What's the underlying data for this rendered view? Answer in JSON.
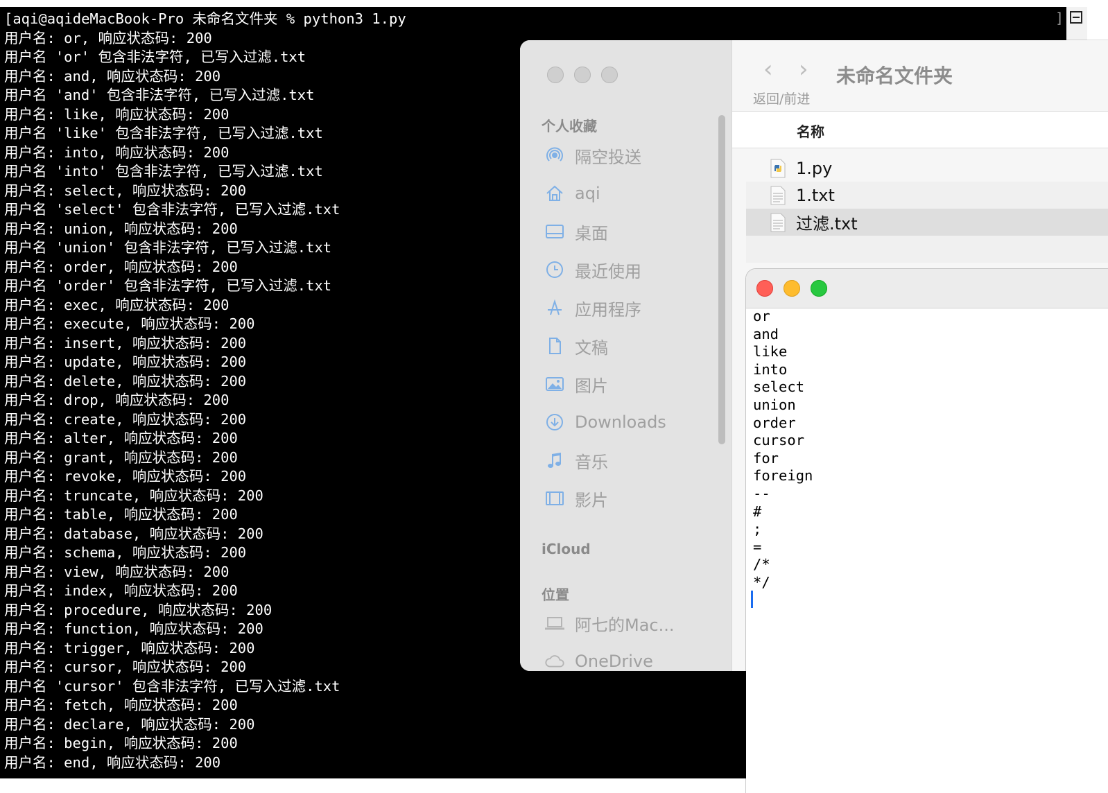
{
  "terminal": {
    "lines": [
      "[aqi@aqideMacBook-Pro 未命名文件夹 % python3 1.py",
      "用户名: or, 响应状态码: 200",
      "用户名 'or' 包含非法字符, 已写入过滤.txt",
      "用户名: and, 响应状态码: 200",
      "用户名 'and' 包含非法字符, 已写入过滤.txt",
      "用户名: like, 响应状态码: 200",
      "用户名 'like' 包含非法字符, 已写入过滤.txt",
      "用户名: into, 响应状态码: 200",
      "用户名 'into' 包含非法字符, 已写入过滤.txt",
      "用户名: select, 响应状态码: 200",
      "用户名 'select' 包含非法字符, 已写入过滤.txt",
      "用户名: union, 响应状态码: 200",
      "用户名 'union' 包含非法字符, 已写入过滤.txt",
      "用户名: order, 响应状态码: 200",
      "用户名 'order' 包含非法字符, 已写入过滤.txt",
      "用户名: exec, 响应状态码: 200",
      "用户名: execute, 响应状态码: 200",
      "用户名: insert, 响应状态码: 200",
      "用户名: update, 响应状态码: 200",
      "用户名: delete, 响应状态码: 200",
      "用户名: drop, 响应状态码: 200",
      "用户名: create, 响应状态码: 200",
      "用户名: alter, 响应状态码: 200",
      "用户名: grant, 响应状态码: 200",
      "用户名: revoke, 响应状态码: 200",
      "用户名: truncate, 响应状态码: 200",
      "用户名: table, 响应状态码: 200",
      "用户名: database, 响应状态码: 200",
      "用户名: schema, 响应状态码: 200",
      "用户名: view, 响应状态码: 200",
      "用户名: index, 响应状态码: 200",
      "用户名: procedure, 响应状态码: 200",
      "用户名: function, 响应状态码: 200",
      "用户名: trigger, 响应状态码: 200",
      "用户名: cursor, 响应状态码: 200",
      "用户名 'cursor' 包含非法字符, 已写入过滤.txt",
      "用户名: fetch, 响应状态码: 200",
      "用户名: declare, 响应状态码: 200",
      "用户名: begin, 响应状态码: 200",
      "用户名: end, 响应状态码: 200"
    ],
    "scroll_bracket": "]"
  },
  "finder": {
    "title": "未命名文件夹",
    "nav_back": "‹",
    "nav_forward": "›",
    "nav_caption": "返回/前进",
    "column_name": "名称",
    "sidebar": {
      "favorites_header": "个人收藏",
      "favorites": [
        {
          "label": "隔空投送",
          "icon": "airdrop-icon"
        },
        {
          "label": "aqi",
          "icon": "home-icon"
        },
        {
          "label": "桌面",
          "icon": "desktop-icon"
        },
        {
          "label": "最近使用",
          "icon": "clock-icon"
        },
        {
          "label": "应用程序",
          "icon": "applications-icon"
        },
        {
          "label": "文稿",
          "icon": "document-icon"
        },
        {
          "label": "图片",
          "icon": "photo-icon"
        },
        {
          "label": "Downloads",
          "icon": "download-icon"
        },
        {
          "label": "音乐",
          "icon": "music-icon"
        },
        {
          "label": "影片",
          "icon": "film-icon"
        }
      ],
      "icloud_header": "iCloud",
      "locations_header": "位置",
      "locations": [
        {
          "label": "阿七的Mac...",
          "icon": "laptop-icon"
        },
        {
          "label": "OneDrive",
          "icon": "cloud-icon"
        }
      ]
    },
    "files": [
      {
        "name": "1.py",
        "icon": "python-file-icon"
      },
      {
        "name": "1.txt",
        "icon": "text-file-icon"
      },
      {
        "name": "过滤.txt",
        "icon": "text-file-icon"
      }
    ]
  },
  "textedit": {
    "lines": [
      "or",
      "and",
      "like",
      "into",
      "select",
      "union",
      "order",
      "cursor",
      "for",
      "foreign",
      "--",
      "#",
      ";",
      "=",
      "/*",
      "*/"
    ],
    "buttons": {
      "close": "#ff5f57",
      "minimize": "#febc2e",
      "zoom": "#28c840"
    }
  }
}
